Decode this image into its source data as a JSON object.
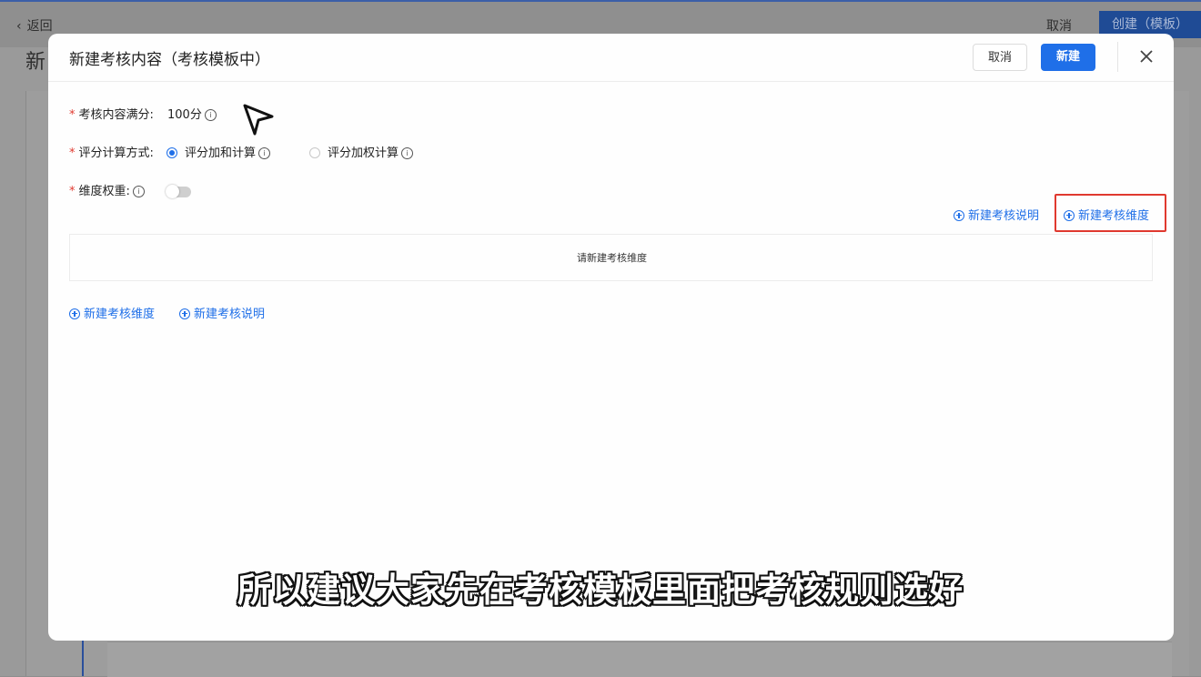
{
  "background": {
    "back_label": "返回",
    "cancel_label": "取消",
    "create_label": "创建（模板）",
    "page_title_fragment": "新"
  },
  "modal": {
    "title": "新建考核内容（考核模板中）",
    "cancel_label": "取消",
    "create_label": "新建",
    "full_score": {
      "label": "考核内容满分:",
      "value": "100分"
    },
    "calc_method": {
      "label": "评分计算方式:",
      "options": [
        {
          "label": "评分加和计算",
          "selected": true
        },
        {
          "label": "评分加权计算",
          "selected": false
        }
      ]
    },
    "weight": {
      "label": "维度权重:",
      "enabled": false
    },
    "top_actions": {
      "add_description": "新建考核说明",
      "add_dimension": "新建考核维度"
    },
    "empty_text": "请新建考核维度",
    "bottom_actions": {
      "add_dimension": "新建考核维度",
      "add_description": "新建考核说明"
    }
  },
  "subtitle": "所以建议大家先在考核模板里面把考核规则选好",
  "colors": {
    "primary": "#1f6fe8",
    "required": "#e0392f",
    "highlight": "#e0392f"
  }
}
